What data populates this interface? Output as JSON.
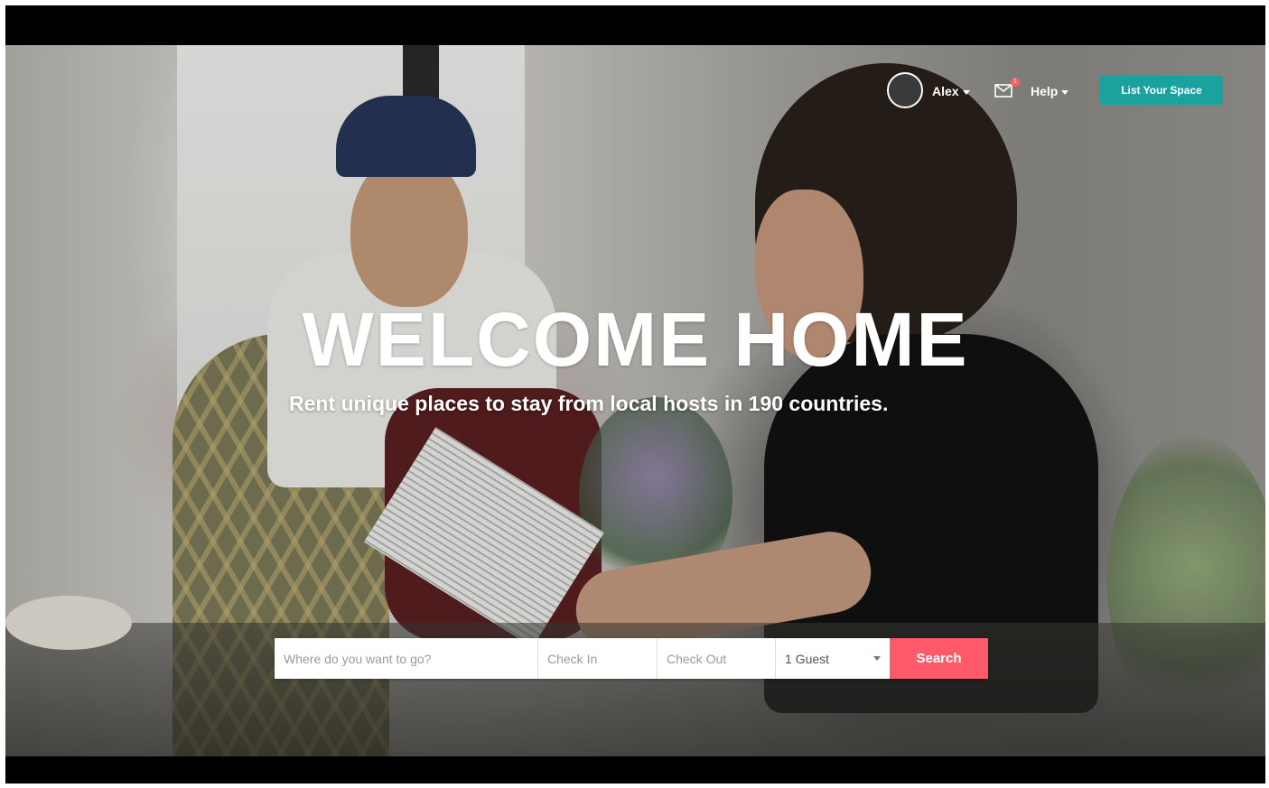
{
  "nav": {
    "user_name": "Alex",
    "notification_count": "1",
    "help_label": "Help",
    "list_space_label": "List Your Space",
    "accent_color": "#1aa39e"
  },
  "hero": {
    "headline": "WELCOME HOME",
    "subheadline": "Rent unique places to stay from local hosts in 190 countries."
  },
  "search": {
    "where_placeholder": "Where do you want to go?",
    "checkin_placeholder": "Check In",
    "checkout_placeholder": "Check Out",
    "guests_value": "1 Guest",
    "search_label": "Search",
    "search_color": "#ff5a6a"
  },
  "icons": {
    "mail": "envelope-icon",
    "user_dropdown": "chevron-down-icon",
    "help_dropdown": "chevron-down-icon",
    "guests_dropdown": "chevron-down-icon"
  }
}
